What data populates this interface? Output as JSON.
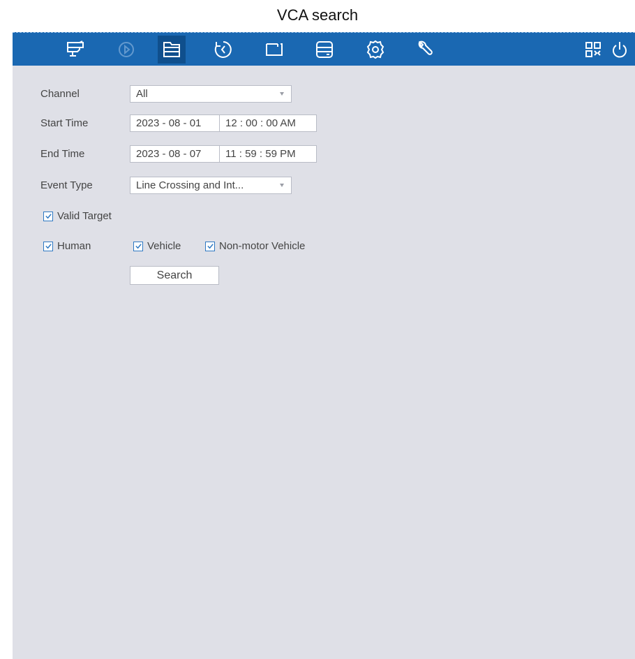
{
  "page": {
    "title": "VCA search"
  },
  "topbar": {
    "icons": [
      "live-view-icon",
      "playback-icon",
      "file-search-icon",
      "event-history-icon",
      "camera-icon",
      "storage-icon",
      "settings-icon",
      "tools-icon",
      "qr-code-icon",
      "power-icon"
    ],
    "accent": "#1a68b2"
  },
  "form": {
    "channel": {
      "label": "Channel",
      "value": "All"
    },
    "start_time": {
      "label": "Start Time",
      "date": "2023 - 08 - 01",
      "time": "12 : 00 : 00  AM"
    },
    "end_time": {
      "label": "End Time",
      "date": "2023 - 08 - 07",
      "time": "11 : 59 : 59  PM"
    },
    "event_type": {
      "label": "Event Type",
      "value": "Line Crossing and Int..."
    },
    "valid_target": {
      "label": "Valid Target",
      "checked": true
    },
    "targets": [
      {
        "label": "Human",
        "checked": true
      },
      {
        "label": "Vehicle",
        "checked": true
      },
      {
        "label": "Non-motor Vehicle",
        "checked": true
      }
    ],
    "search_label": "Search"
  }
}
